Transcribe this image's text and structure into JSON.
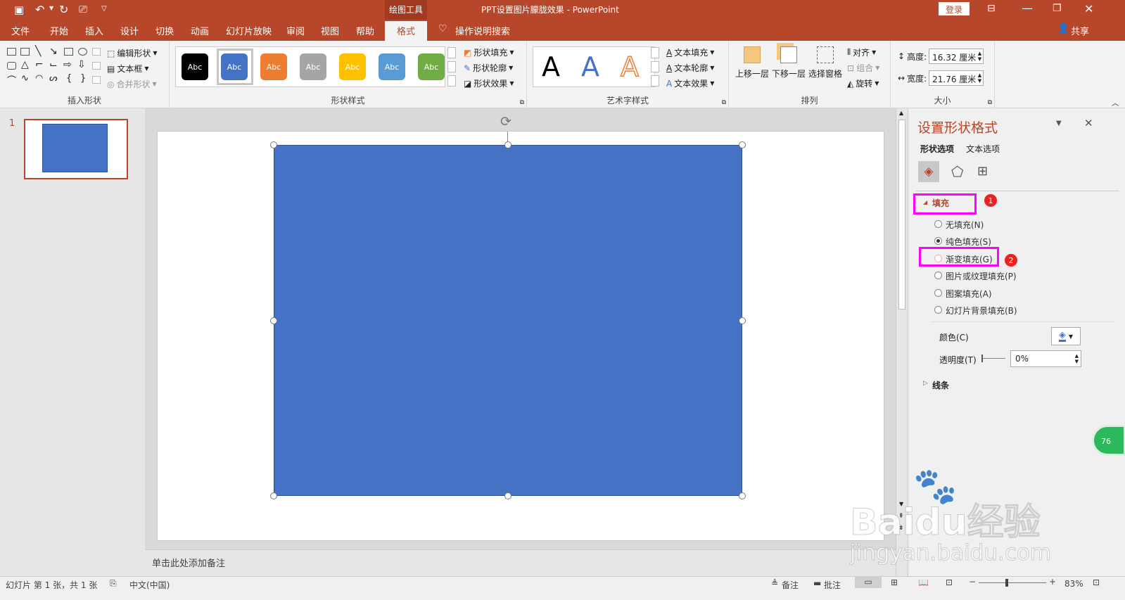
{
  "titlebar": {
    "context_tab": "绘图工具",
    "title": "PPT设置图片朦胧效果  -  PowerPoint",
    "login": "登录"
  },
  "tabs": [
    "文件",
    "开始",
    "插入",
    "设计",
    "切换",
    "动画",
    "幻灯片放映",
    "审阅",
    "视图",
    "帮助",
    "格式"
  ],
  "active_tab": "格式",
  "tell_me": "操作说明搜索",
  "share": "共享",
  "ribbon": {
    "insert_shapes": {
      "label": "插入形状",
      "edit_shape": "编辑形状",
      "text_box": "文本框",
      "merge_shapes": "合并形状"
    },
    "shape_styles": {
      "label": "形状样式",
      "swatch_text": "Abc",
      "fill": "形状填充",
      "outline": "形状轮廓",
      "effects": "形状效果",
      "swatches": [
        {
          "bg": "#000000"
        },
        {
          "bg": "#4472c4"
        },
        {
          "bg": "#ed7d31"
        },
        {
          "bg": "#a5a5a5"
        },
        {
          "bg": "#ffc000"
        },
        {
          "bg": "#5b9bd5"
        },
        {
          "bg": "#70ad47"
        }
      ]
    },
    "wordart": {
      "label": "艺术字样式",
      "letter": "A",
      "text_fill": "文本填充",
      "text_outline": "文本轮廓",
      "text_effects": "文本效果"
    },
    "arrange": {
      "label": "排列",
      "bring_forward": "上移一层",
      "send_backward": "下移一层",
      "selection_pane": "选择窗格",
      "align": "对齐",
      "group": "组合",
      "rotate": "旋转"
    },
    "size": {
      "label": "大小",
      "height_label": "高度:",
      "height_value": "16.32 厘米",
      "width_label": "宽度:",
      "width_value": "21.76 厘米"
    }
  },
  "thumbnail": {
    "number": "1"
  },
  "notes_placeholder": "单击此处添加备注",
  "format_pane": {
    "title": "设置形状格式",
    "tab_shape": "形状选项",
    "tab_text": "文本选项",
    "fill_section": "填充",
    "options": [
      "无填充(N)",
      "纯色填充(S)",
      "渐变填充(G)",
      "图片或纹理填充(P)",
      "图案填充(A)",
      "幻灯片背景填充(B)"
    ],
    "selected_option": "纯色填充(S)",
    "color_label": "颜色(C)",
    "transparency_label": "透明度(T)",
    "transparency_value": "0%",
    "line_section": "线条",
    "badge1": "1",
    "badge2": "2"
  },
  "status": {
    "slide_info": "幻灯片 第 1 张，共 1 张",
    "language": "中文(中国)",
    "notes": "备注",
    "comments": "批注",
    "zoom": "83%"
  },
  "watermark": {
    "brand": "Baidu经验",
    "url": "jingyan.baidu.com",
    "bubble": "76"
  },
  "colors": {
    "accent": "#b7472a",
    "shape_fill": "#4472c4",
    "highlight": "#ff00ff"
  }
}
